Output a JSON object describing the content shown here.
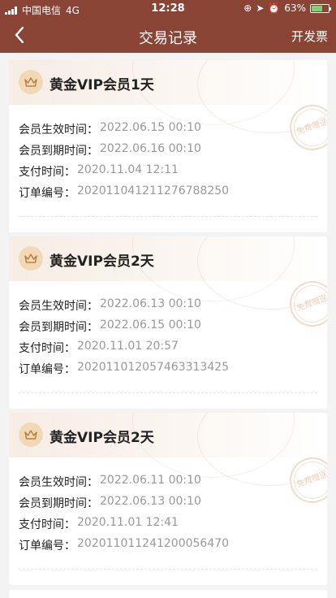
{
  "status_bar": {
    "carrier": "中国电信",
    "network": "4G",
    "time": "12:28",
    "battery": "63%",
    "battery_level": 0.63
  },
  "nav": {
    "title": "交易记录",
    "action": "开发票"
  },
  "colors": {
    "header_bg": "#8a4436",
    "page_bg": "#f3f3f3",
    "value_text": "#999999"
  },
  "labels": {
    "start": "会员生效时间：",
    "end": "会员到期时间：",
    "paid": "支付时间：",
    "order": "订单编号："
  },
  "stamp_text": "免费赠送",
  "records": [
    {
      "title": "黄金VIP会员1天",
      "start": "2022.06.15 00:10",
      "end": "2022.06.16 00:10",
      "paid": "2020.11.04 12:11",
      "order": "20201104121127678825​0"
    },
    {
      "title": "黄金VIP会员2天",
      "start": "2022.06.13 00:10",
      "end": "2022.06.15 00:10",
      "paid": "2020.11.01 20:57",
      "order": "202011012057463313425"
    },
    {
      "title": "黄金VIP会员2天",
      "start": "2022.06.11 00:10",
      "end": "2022.06.13 00:10",
      "paid": "2020.11.01 12:41",
      "order": "202011011241200056470"
    }
  ]
}
